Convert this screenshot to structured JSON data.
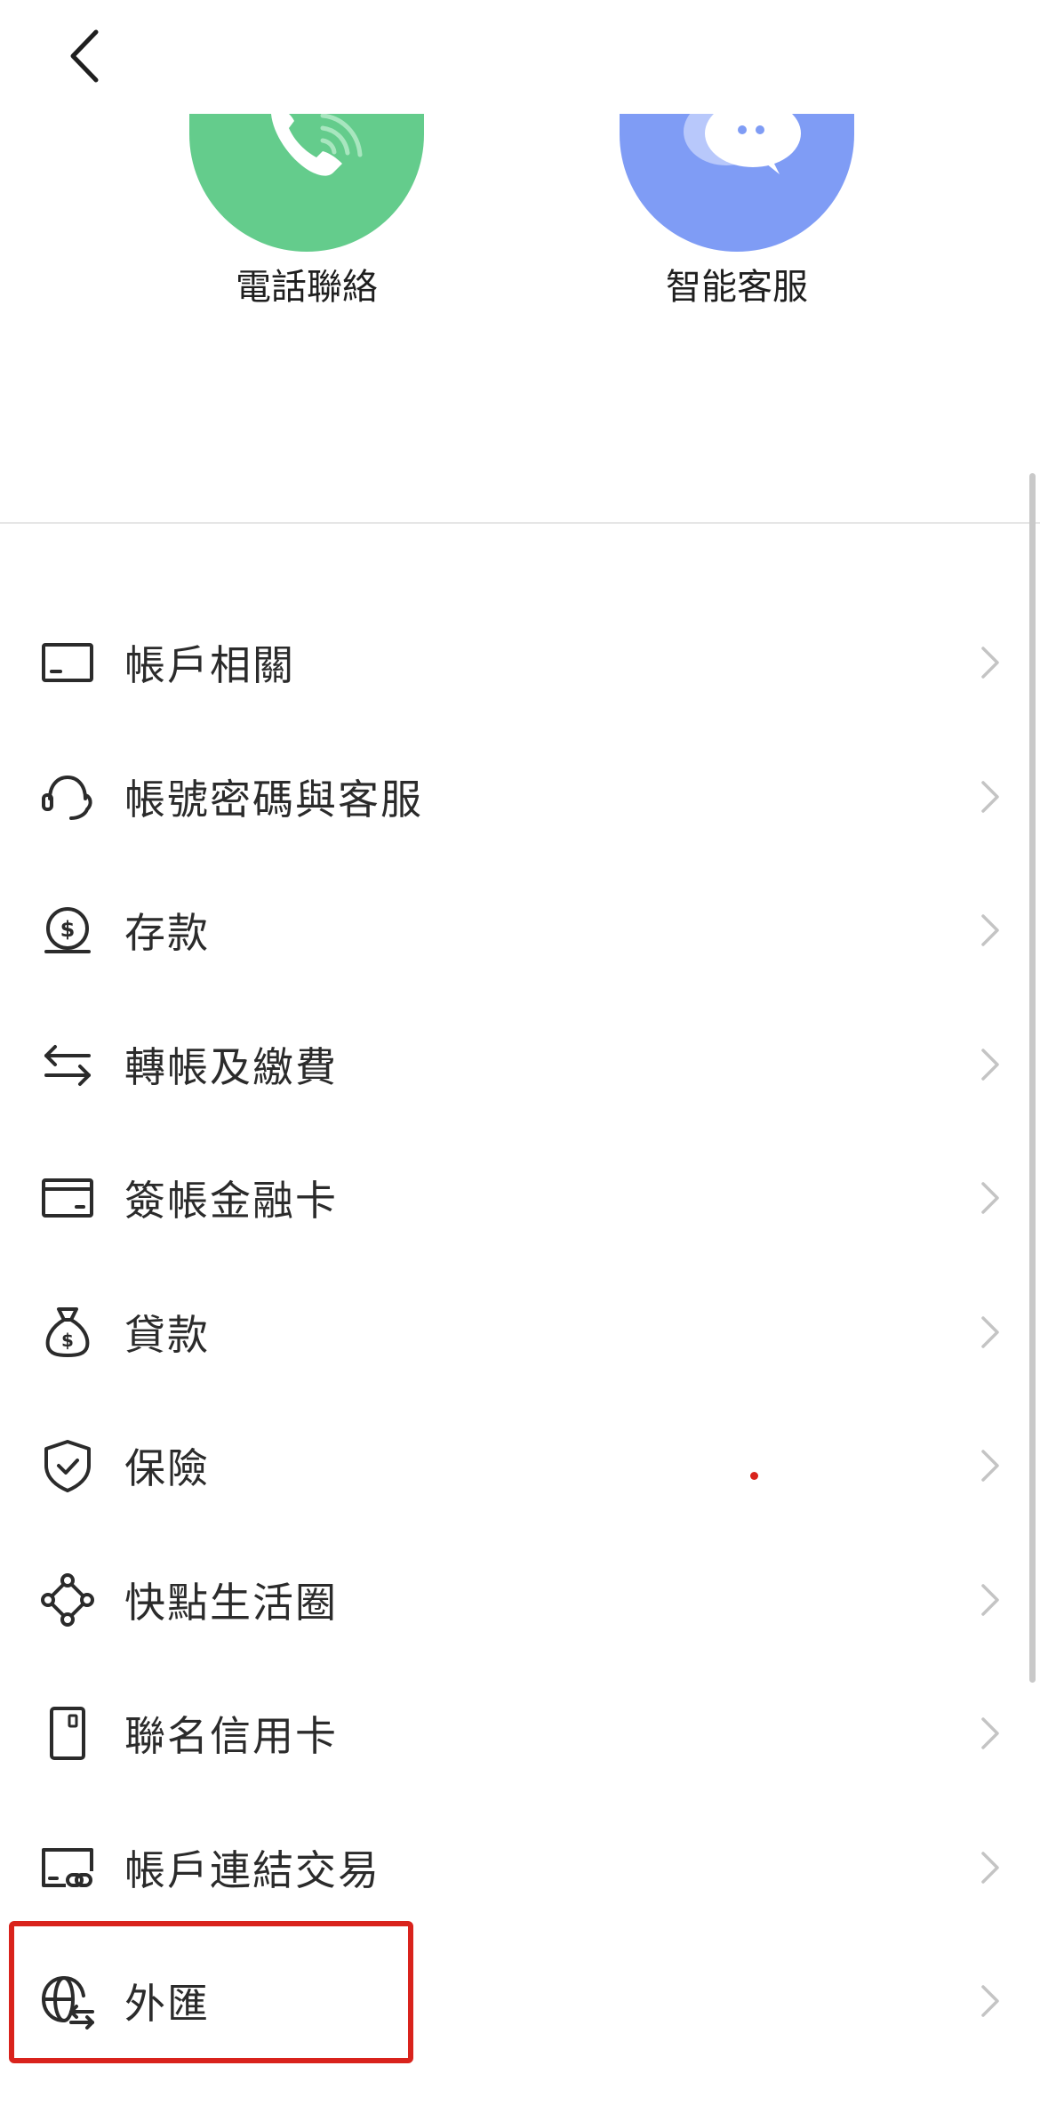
{
  "header": {
    "back_icon": "chevron-left-icon"
  },
  "contact": {
    "phone": {
      "label": "電話聯絡",
      "icon": "phone-icon",
      "color": "#64cc8c"
    },
    "ai_service": {
      "label": "智能客服",
      "icon": "chat-bubble-icon",
      "color": "#7f9cf5"
    }
  },
  "menu": {
    "items": [
      {
        "label": "帳戶相關",
        "icon": "account-icon"
      },
      {
        "label": "帳號密碼與客服",
        "icon": "headset-icon"
      },
      {
        "label": "存款",
        "icon": "deposit-icon"
      },
      {
        "label": "轉帳及繳費",
        "icon": "transfer-icon"
      },
      {
        "label": "簽帳金融卡",
        "icon": "debit-card-icon"
      },
      {
        "label": "貸款",
        "icon": "money-bag-icon"
      },
      {
        "label": "保險",
        "icon": "shield-icon"
      },
      {
        "label": "快點生活圈",
        "icon": "network-icon"
      },
      {
        "label": "聯名信用卡",
        "icon": "credit-card-icon"
      },
      {
        "label": "帳戶連結交易",
        "icon": "link-account-icon"
      },
      {
        "label": "外匯",
        "icon": "globe-exchange-icon"
      }
    ]
  },
  "colors": {
    "highlight": "#d9231c",
    "text": "#2b2b2b",
    "chevron": "#c4c4c4"
  }
}
